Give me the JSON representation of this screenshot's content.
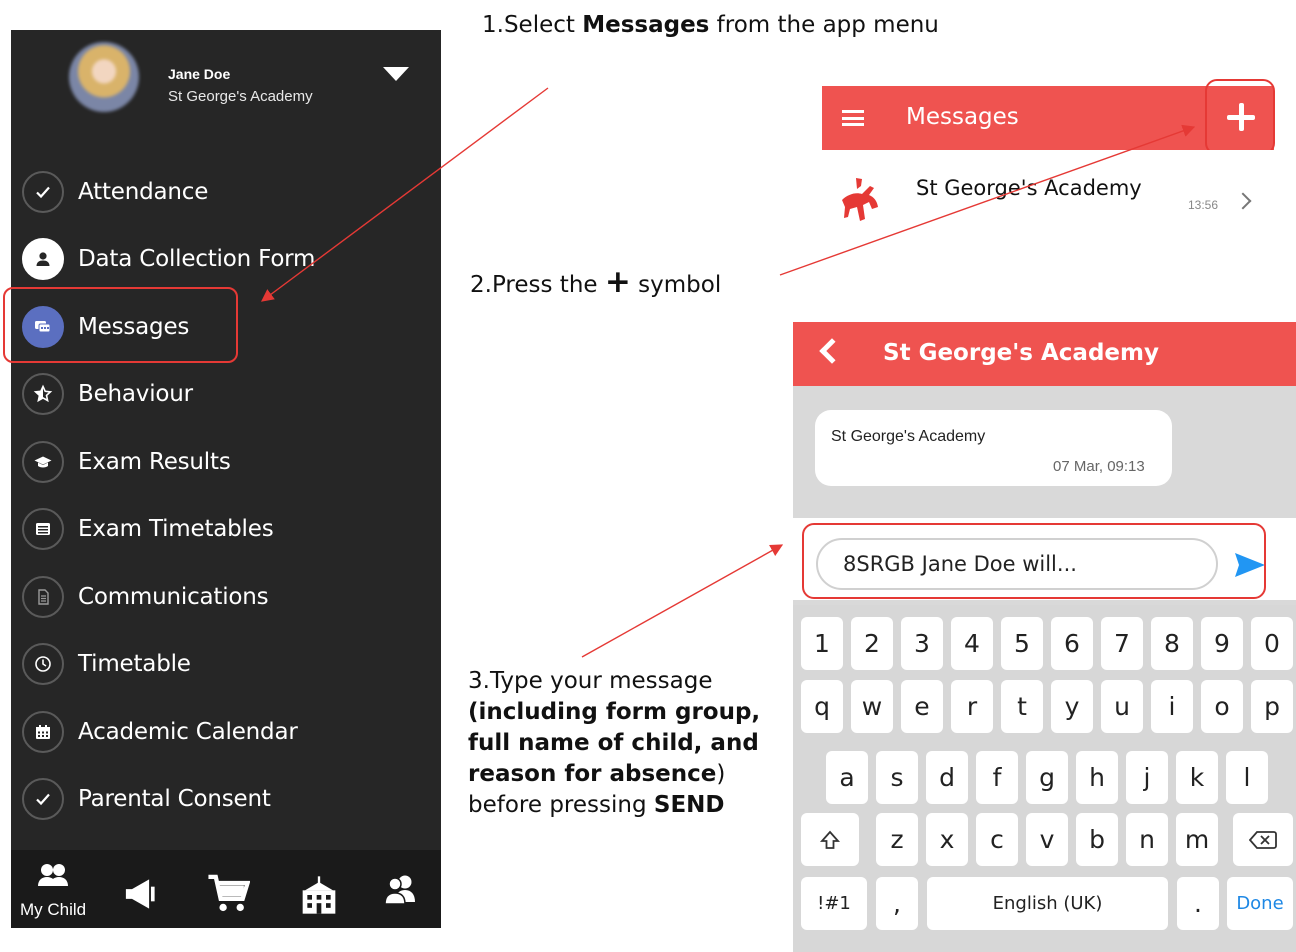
{
  "step1": {
    "num": "1.",
    "pre": "Select ",
    "bold": "Messages",
    "post": " from the app menu"
  },
  "step2": {
    "num": "2.",
    "pre": "Press the ",
    "symbol": "+",
    "post": " symbol"
  },
  "step3": {
    "line1": "3.Type your message",
    "line2": "(including form group,",
    "line3": "full name of child, and",
    "line4_bold": "reason for absence",
    "line4_rest": ")",
    "line5_pre": "before pressing ",
    "line5_bold": "SEND"
  },
  "profile": {
    "name": "Jane Doe",
    "school": "St George's Academy"
  },
  "menu": {
    "items": [
      {
        "label": "Attendance",
        "icon": "check-icon"
      },
      {
        "label": "Data Collection Form",
        "icon": "person-icon"
      },
      {
        "label": "Messages",
        "icon": "chat-icon"
      },
      {
        "label": "Behaviour",
        "icon": "star-icon"
      },
      {
        "label": "Exam Results",
        "icon": "graduation-cap-icon"
      },
      {
        "label": "Exam Timetables",
        "icon": "list-icon"
      },
      {
        "label": "Communications",
        "icon": "document-icon"
      },
      {
        "label": "Timetable",
        "icon": "clock-icon"
      },
      {
        "label": "Academic Calendar",
        "icon": "calendar-icon"
      },
      {
        "label": "Parental Consent",
        "icon": "check-icon"
      }
    ]
  },
  "bottom_nav": {
    "my_child": "My Child"
  },
  "messages_screen": {
    "title": "Messages",
    "row": {
      "name": "St George's Academy",
      "time": "13:56"
    }
  },
  "conversation": {
    "title": "St George's Academy",
    "bubble": {
      "name": "St George's Academy",
      "time": "07 Mar, 09:13"
    },
    "input_value": "8SRGB Jane Doe will..."
  },
  "keyboard": {
    "row1": [
      "1",
      "2",
      "3",
      "4",
      "5",
      "6",
      "7",
      "8",
      "9",
      "0"
    ],
    "row2": [
      "q",
      "w",
      "e",
      "r",
      "t",
      "y",
      "u",
      "i",
      "o",
      "p"
    ],
    "row3": [
      "a",
      "s",
      "d",
      "f",
      "g",
      "h",
      "j",
      "k",
      "l"
    ],
    "row4": [
      "z",
      "x",
      "c",
      "v",
      "b",
      "n",
      "m"
    ],
    "symbols": "!#1",
    "comma": ",",
    "space": "English (UK)",
    "period": ".",
    "done": "Done"
  },
  "colors": {
    "header_red": "#ef5350",
    "annotation_red": "#e53935",
    "menu_bg": "#262626",
    "active_icon": "#5b6fc0",
    "done_blue": "#1e88e5"
  }
}
